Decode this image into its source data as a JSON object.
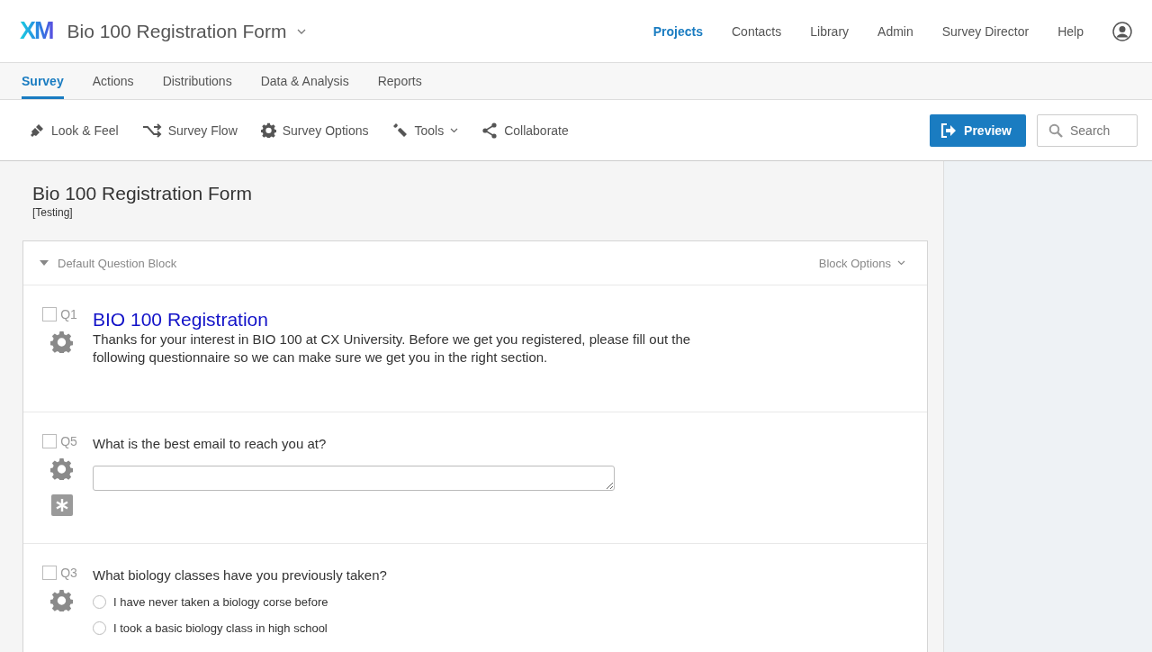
{
  "logo": "XM",
  "project": {
    "title": "Bio 100 Registration Form"
  },
  "top_nav": [
    {
      "label": "Projects",
      "selected": true
    },
    {
      "label": "Contacts",
      "selected": false
    },
    {
      "label": "Library",
      "selected": false
    },
    {
      "label": "Admin",
      "selected": false
    },
    {
      "label": "Survey Director",
      "selected": false
    },
    {
      "label": "Help",
      "selected": false
    }
  ],
  "tabs": [
    {
      "label": "Survey",
      "selected": true
    },
    {
      "label": "Actions",
      "selected": false
    },
    {
      "label": "Distributions",
      "selected": false
    },
    {
      "label": "Data & Analysis",
      "selected": false
    },
    {
      "label": "Reports",
      "selected": false
    }
  ],
  "toolbar": [
    {
      "label": "Look & Feel",
      "dropdown": false
    },
    {
      "label": "Survey Flow",
      "dropdown": false
    },
    {
      "label": "Survey Options",
      "dropdown": false
    },
    {
      "label": "Tools",
      "dropdown": true
    },
    {
      "label": "Collaborate",
      "dropdown": false
    }
  ],
  "preview_button": "Preview",
  "search": {
    "placeholder": "Search"
  },
  "survey": {
    "title": "Bio 100 Registration Form",
    "status": "[Testing]"
  },
  "block": {
    "title": "Default Question Block",
    "expanded": true,
    "options_label": "Block Options"
  },
  "questions": [
    {
      "kind": "text",
      "number": "Q1",
      "checked": false,
      "required": false,
      "title": "BIO 100 Registration",
      "text": "Thanks for your interest in BIO 100 at CX University. Before we get you registered, please fill out the following questionnaire so we can make sure we get you in the right section."
    },
    {
      "kind": "text_entry",
      "number": "Q5",
      "checked": false,
      "required": true,
      "text": "What is the best email to reach you at?"
    },
    {
      "kind": "multiple_choice",
      "number": "Q3",
      "checked": false,
      "required": false,
      "text": "What biology classes have you previously taken?",
      "choices": [
        {
          "label": "I have never taken a biology corse before",
          "selected": false
        },
        {
          "label": "I took a basic biology class in high school",
          "selected": false
        }
      ]
    }
  ]
}
